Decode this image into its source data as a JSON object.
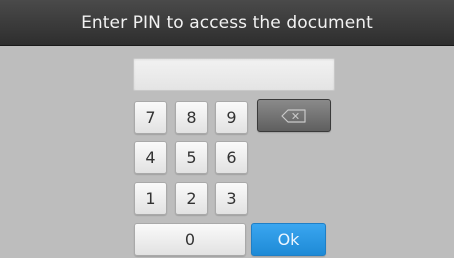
{
  "title": "Enter PIN to access the document",
  "pin_field": {
    "value": ""
  },
  "keys": {
    "k7": "7",
    "k8": "8",
    "k9": "9",
    "k4": "4",
    "k5": "5",
    "k6": "6",
    "k1": "1",
    "k2": "2",
    "k3": "3",
    "k0": "0",
    "ok": "Ok"
  },
  "icons": {
    "backspace": "backspace-icon"
  },
  "colors": {
    "title_bar": "#3a3a3a",
    "background": "#bdbdbd",
    "ok_button": "#2a97e0",
    "backspace_button": "#6e6e6e"
  }
}
